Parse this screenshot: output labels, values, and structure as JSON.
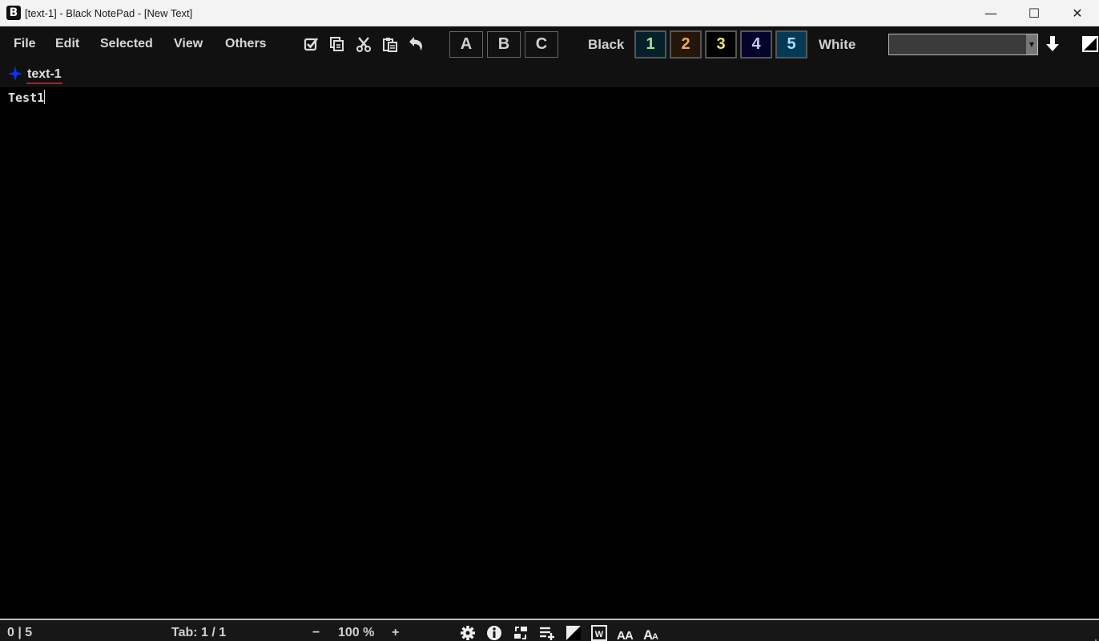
{
  "window": {
    "app_icon_letter": "B",
    "title": "[text-1] - Black NotePad - [New Text]",
    "minimize": "—",
    "maximize": "☐",
    "close": "✕"
  },
  "menu": {
    "items": [
      "File",
      "Edit",
      "Selected",
      "View",
      "Others"
    ]
  },
  "toolbar": {
    "icons": [
      "select-all-icon",
      "copy-icon",
      "cut-icon",
      "paste-icon",
      "undo-icon"
    ],
    "abc_buttons": [
      "A",
      "B",
      "C"
    ],
    "black_label": "Black",
    "white_label": "White",
    "color_presets": [
      {
        "label": "1",
        "bg": "#06202a",
        "fg": "#9be39b"
      },
      {
        "label": "2",
        "bg": "#241608",
        "fg": "#f0a868"
      },
      {
        "label": "3",
        "bg": "#000000",
        "fg": "#f2e46a"
      },
      {
        "label": "4",
        "bg": "#04042a",
        "fg": "#c8c8f0"
      },
      {
        "label": "5",
        "bg": "#053a55",
        "fg": "#a8e0ff"
      }
    ],
    "font_select_value": "",
    "down_arrow": "🡇"
  },
  "tabs": [
    {
      "label": "text-1",
      "icon": "blue-star-icon",
      "active": true
    }
  ],
  "editor": {
    "content": "Test1"
  },
  "status": {
    "position": "0 | 5",
    "tab_info": "Tab: 1 / 1",
    "zoom_minus": "−",
    "zoom_level": "100 %",
    "zoom_plus": "+"
  }
}
